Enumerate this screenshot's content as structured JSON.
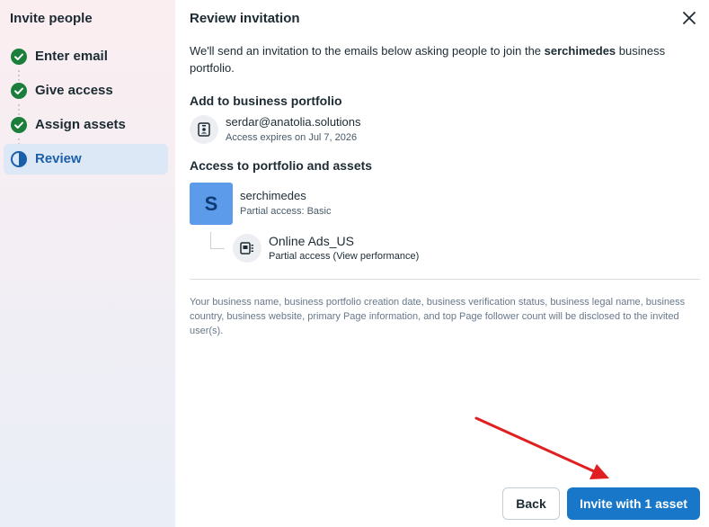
{
  "sidebar": {
    "title": "Invite people",
    "steps": [
      {
        "label": "Enter email",
        "state": "done"
      },
      {
        "label": "Give access",
        "state": "done"
      },
      {
        "label": "Assign assets",
        "state": "done"
      },
      {
        "label": "Review",
        "state": "active"
      }
    ]
  },
  "main": {
    "title": "Review invitation",
    "intro_prefix": "We'll send an invitation to the emails below asking people to join the ",
    "intro_business": "serchimedes",
    "intro_suffix": " business portfolio.",
    "add_section_title": "Add to business portfolio",
    "invitee": {
      "email": "serdar@anatolia.solutions",
      "expires": "Access expires on Jul 7, 2026"
    },
    "access_section_title": "Access to portfolio and assets",
    "portfolio": {
      "avatar_letter": "S",
      "name": "serchimedes",
      "access": "Partial access: Basic"
    },
    "asset": {
      "name": "Online Ads_US",
      "access": "Partial access (View performance)"
    },
    "disclaimer": "Your business name, business portfolio creation date, business verification status, business legal name, business country, business website, primary Page information, and top Page follower count will be disclosed to the invited user(s)."
  },
  "footer": {
    "back_label": "Back",
    "invite_label": "Invite with 1 asset"
  },
  "colors": {
    "check_green": "#1b7f3b",
    "active_blue": "#1a5fa8",
    "primary_button": "#1877c8",
    "avatar_bg": "#5b9bea",
    "annotation_arrow": "#e02020"
  }
}
